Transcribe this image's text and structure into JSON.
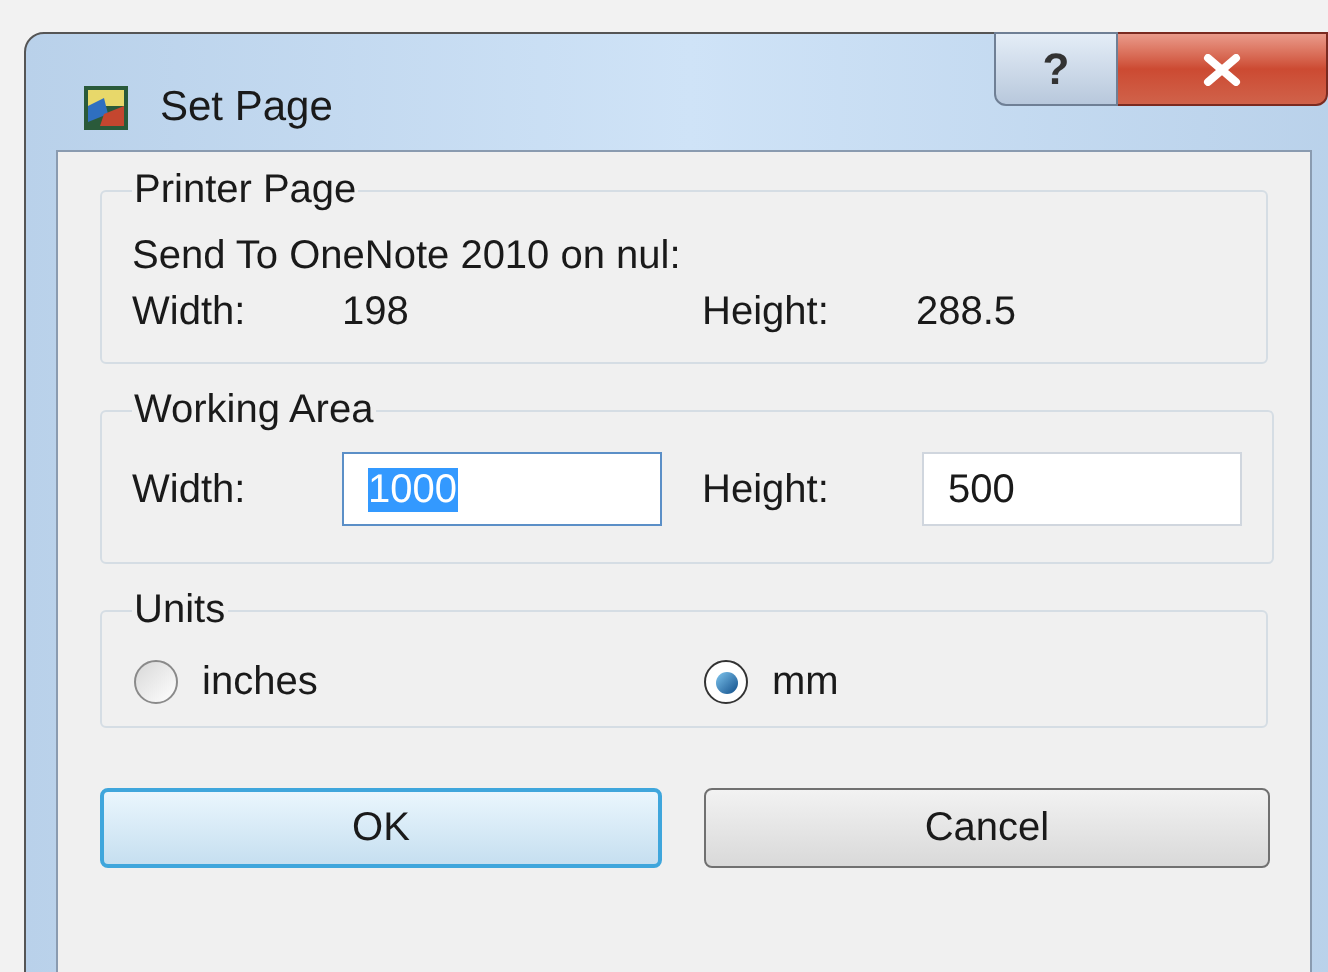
{
  "window": {
    "title": "Set Page",
    "help_button": "?"
  },
  "printer_page": {
    "title": "Printer Page",
    "device": "Send To OneNote 2010 on nul:",
    "width_label": "Width:",
    "width_value": "198",
    "height_label": "Height:",
    "height_value": "288.5"
  },
  "working_area": {
    "title": "Working Area",
    "width_label": "Width:",
    "width": {
      "value": "1000",
      "text_selected": true
    },
    "height_label": "Height:",
    "height": {
      "value": "500",
      "text_selected": false
    }
  },
  "units": {
    "title": "Units",
    "options": [
      {
        "label": "inches",
        "selected": false
      },
      {
        "label": "mm",
        "selected": true
      }
    ]
  },
  "buttons": [
    {
      "label": "OK",
      "default": true
    },
    {
      "label": "Cancel",
      "default": false
    }
  ]
}
